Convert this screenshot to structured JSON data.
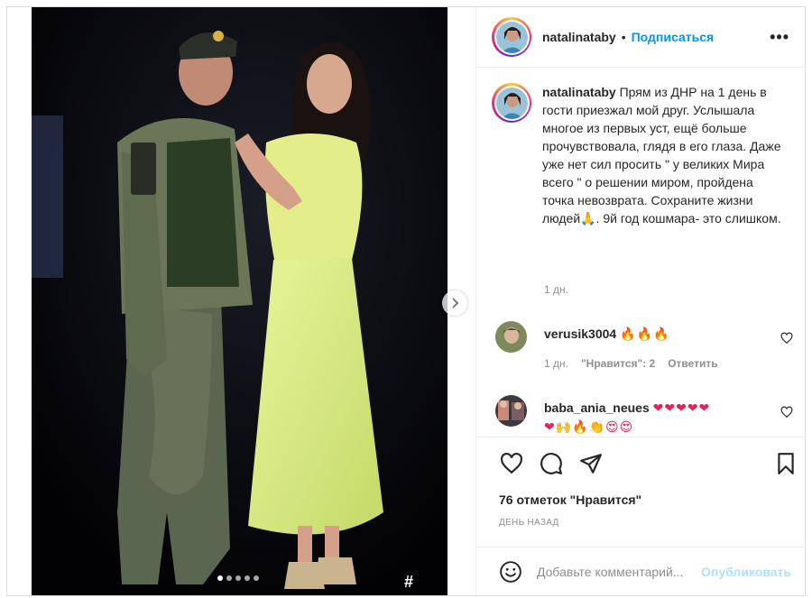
{
  "post": {
    "username": "natalinataby",
    "follow_label": "Подписаться",
    "more_label": "•••",
    "separator": "•"
  },
  "media": {
    "photo_description_icon": "hashtag-icon",
    "photo_badge": "#",
    "carousel_count": 5,
    "carousel_active": 0
  },
  "caption": {
    "username": "natalinataby",
    "text": "Прям из ДНР на 1 день в гости приезжал мой друг. Услышала многое из первых уст, ещё больше прочувствовала, глядя в его глаза. Даже уже нет сил просить \" у великих Мира всего \" о решении миром, пройдена точка невозврата. Сохраните жизни людей🙏. 9й год кошмара- это слишком.",
    "time": "1 дн."
  },
  "comments": [
    {
      "username": "verusik3004",
      "text": "🔥🔥🔥",
      "time": "1 дн.",
      "likes": "\"Нравится\": 2",
      "reply": "Ответить"
    },
    {
      "username": "baba_ania_neues",
      "text_line1": "❤❤❤❤❤",
      "text_line2": "❤🙌🔥👏😍😍"
    }
  ],
  "actions": {
    "likes": "76 отметок \"Нравится\"",
    "date": "ДЕНЬ НАЗАД"
  },
  "add_comment": {
    "placeholder": "Добавьте комментарий...",
    "publish": "Опубликовать"
  },
  "colors": {
    "accent": "#0095f6",
    "publish_disabled": "#b2dffc",
    "meta": "#8e8e8e",
    "border": "#dbdbdb"
  }
}
